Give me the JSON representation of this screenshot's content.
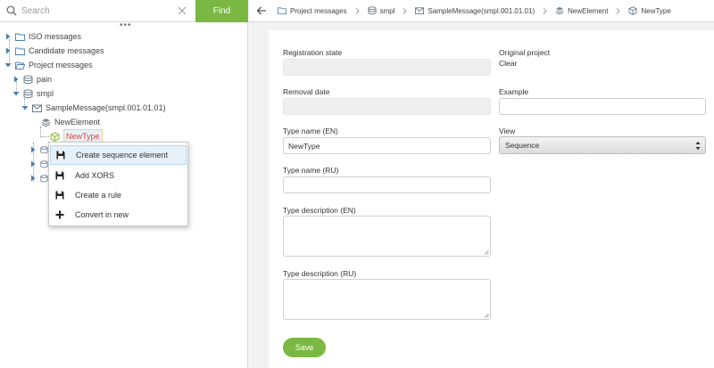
{
  "search": {
    "placeholder": "Search",
    "value": "",
    "find_label": "Find"
  },
  "tree": {
    "items": [
      {
        "label": "ISO messages",
        "icon": "folder-icon"
      },
      {
        "label": "Candidate messages",
        "icon": "folder-icon"
      },
      {
        "label": "Project messages",
        "icon": "folder-open-icon"
      },
      {
        "label": "pain",
        "icon": "database-icon"
      },
      {
        "label": "smpl",
        "icon": "database-icon"
      },
      {
        "label": "SampleMessage(smpl.001.01.01)",
        "icon": "envelope-icon"
      },
      {
        "label": "NewElement",
        "icon": "stack-icon"
      },
      {
        "label": "NewType",
        "icon": "cube-icon"
      }
    ]
  },
  "context_menu": {
    "items": [
      {
        "label": "Create sequence element",
        "icon": "save-icon"
      },
      {
        "label": "Add XORS",
        "icon": "save-icon"
      },
      {
        "label": "Create a rule",
        "icon": "save-icon"
      },
      {
        "label": "Convert in new",
        "icon": "plus-icon"
      }
    ]
  },
  "breadcrumb": {
    "items": [
      {
        "label": "Project messages",
        "icon": "folder-icon"
      },
      {
        "label": "smpl",
        "icon": "database-icon"
      },
      {
        "label": "SampleMessage(smpl.001.01.01)",
        "icon": "envelope-icon"
      },
      {
        "label": "NewElement",
        "icon": "stack-icon"
      },
      {
        "label": "NewType",
        "icon": "cube-icon"
      }
    ]
  },
  "form": {
    "registration_state": {
      "label": "Registration state",
      "value": ""
    },
    "original_project": {
      "label": "Original project",
      "value": "Clear"
    },
    "removal_date": {
      "label": "Removal date",
      "value": ""
    },
    "example": {
      "label": "Example",
      "value": ""
    },
    "type_name_en": {
      "label": "Type name (EN)",
      "value": "NewType"
    },
    "view": {
      "label": "View",
      "value": "Sequence"
    },
    "type_name_ru": {
      "label": "Type name (RU)",
      "value": ""
    },
    "type_desc_en": {
      "label": "Type description (EN)",
      "value": ""
    },
    "type_desc_ru": {
      "label": "Type description (RU)",
      "value": ""
    },
    "save_label": "Save"
  },
  "colors": {
    "accent": "#7ab843",
    "selected_text": "#d9443a",
    "icon_blue": "#4a7fb0"
  }
}
